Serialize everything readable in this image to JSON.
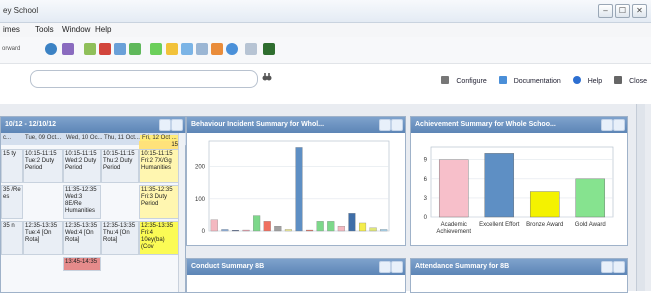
{
  "window": {
    "title": "ey School",
    "controls": [
      "–",
      "☐",
      "✕"
    ]
  },
  "menu": {
    "items": [
      "imes",
      "Tools",
      "Window",
      "Help"
    ]
  },
  "toolbar": {
    "forward_label": "orward"
  },
  "search": {
    "placeholder": ""
  },
  "header_links": {
    "configure": "Configure",
    "documentation": "Documentation",
    "help": "Help",
    "close": "Close"
  },
  "calendar": {
    "title": "10/12 - 12/10/12",
    "days": [
      "c...",
      "Tue, 09 Oct...",
      "Wed, 10 Oc...",
      "Thu, 11 Oct...",
      "Fri, 12 Oct ..."
    ],
    "today_num": "15",
    "slots": [
      {
        "col": 0,
        "row": 0,
        "text": "15 ty"
      },
      {
        "col": 1,
        "row": 0,
        "text": "10:15-11:15 Tue:2 Duty Period"
      },
      {
        "col": 2,
        "row": 0,
        "text": "10:15-11:15 Wed:2 Duty Period"
      },
      {
        "col": 3,
        "row": 0,
        "text": "10:15-11:15 Thu:2 Duty Period"
      },
      {
        "col": 4,
        "row": 0,
        "text": "10:15-11:15 Fri:2 7X/Gg Humanities"
      },
      {
        "col": 0,
        "row": 1,
        "text": "35 /Re es"
      },
      {
        "col": 2,
        "row": 1,
        "text": "11:35-12:35 Wed:3 8E/Re Humanities"
      },
      {
        "col": 4,
        "row": 1,
        "text": "11:35-12:35 Fri:3 Duty Period"
      },
      {
        "col": 0,
        "row": 2,
        "text": "35 n"
      },
      {
        "col": 1,
        "row": 2,
        "text": "12:35-13:35 Tue:4 [On Rota]"
      },
      {
        "col": 2,
        "row": 2,
        "text": "12:35-13:35 Wed:4 [On Rota]"
      },
      {
        "col": 3,
        "row": 2,
        "text": "12:35-13:35 Thu:4 [On Rota]"
      },
      {
        "col": 4,
        "row": 2,
        "text": "12:35-13:35 Fri:4 10ey(ba)(Cov"
      },
      {
        "col": 2,
        "row": 3,
        "text": "13:45-14:35"
      }
    ]
  },
  "panels": {
    "behaviour_title": "Behaviour Incident Summary for Whol...",
    "achievement_title": "Achievement Summary for Whole Schoo...",
    "conduct_title": "Conduct Summary 8B",
    "attendance_title": "Attendance Summary for 8B"
  },
  "chart_data": [
    {
      "type": "bar",
      "title": "Behaviour Incident Summary for Whol...",
      "ylim": [
        0,
        280
      ],
      "yticks": [
        0,
        100,
        200
      ],
      "grid": true,
      "series": [
        {
          "values": [
            35,
            5,
            2,
            3,
            48,
            30,
            15,
            5,
            260,
            3,
            30,
            30,
            15,
            55,
            25,
            10,
            5
          ]
        }
      ],
      "colors": [
        "#f4b8c0",
        "#8fb0dc",
        "#1f3d7a",
        "#f4a0b0",
        "#7dd88a",
        "#f07060",
        "#a0a0a0",
        "#f1ed9a",
        "#5e8fc4",
        "#f07060",
        "#7dd88a",
        "#7dd88a",
        "#f4b8c0",
        "#3f6ea8",
        "#f4ed4c",
        "#dfe678",
        "#a9d7f1"
      ]
    },
    {
      "type": "bar",
      "title": "Achievement Summary for Whole Schoo...",
      "categories": [
        "Academic Achievement",
        "Excellent Effort",
        "Bronze Award",
        "Gold Award"
      ],
      "values": [
        9,
        10,
        4,
        6
      ],
      "ylim": [
        0,
        11
      ],
      "yticks": [
        0,
        3,
        6,
        9
      ],
      "grid": true,
      "colors": [
        "#f7bfca",
        "#5e8fc4",
        "#f4f200",
        "#86e38f"
      ]
    }
  ]
}
